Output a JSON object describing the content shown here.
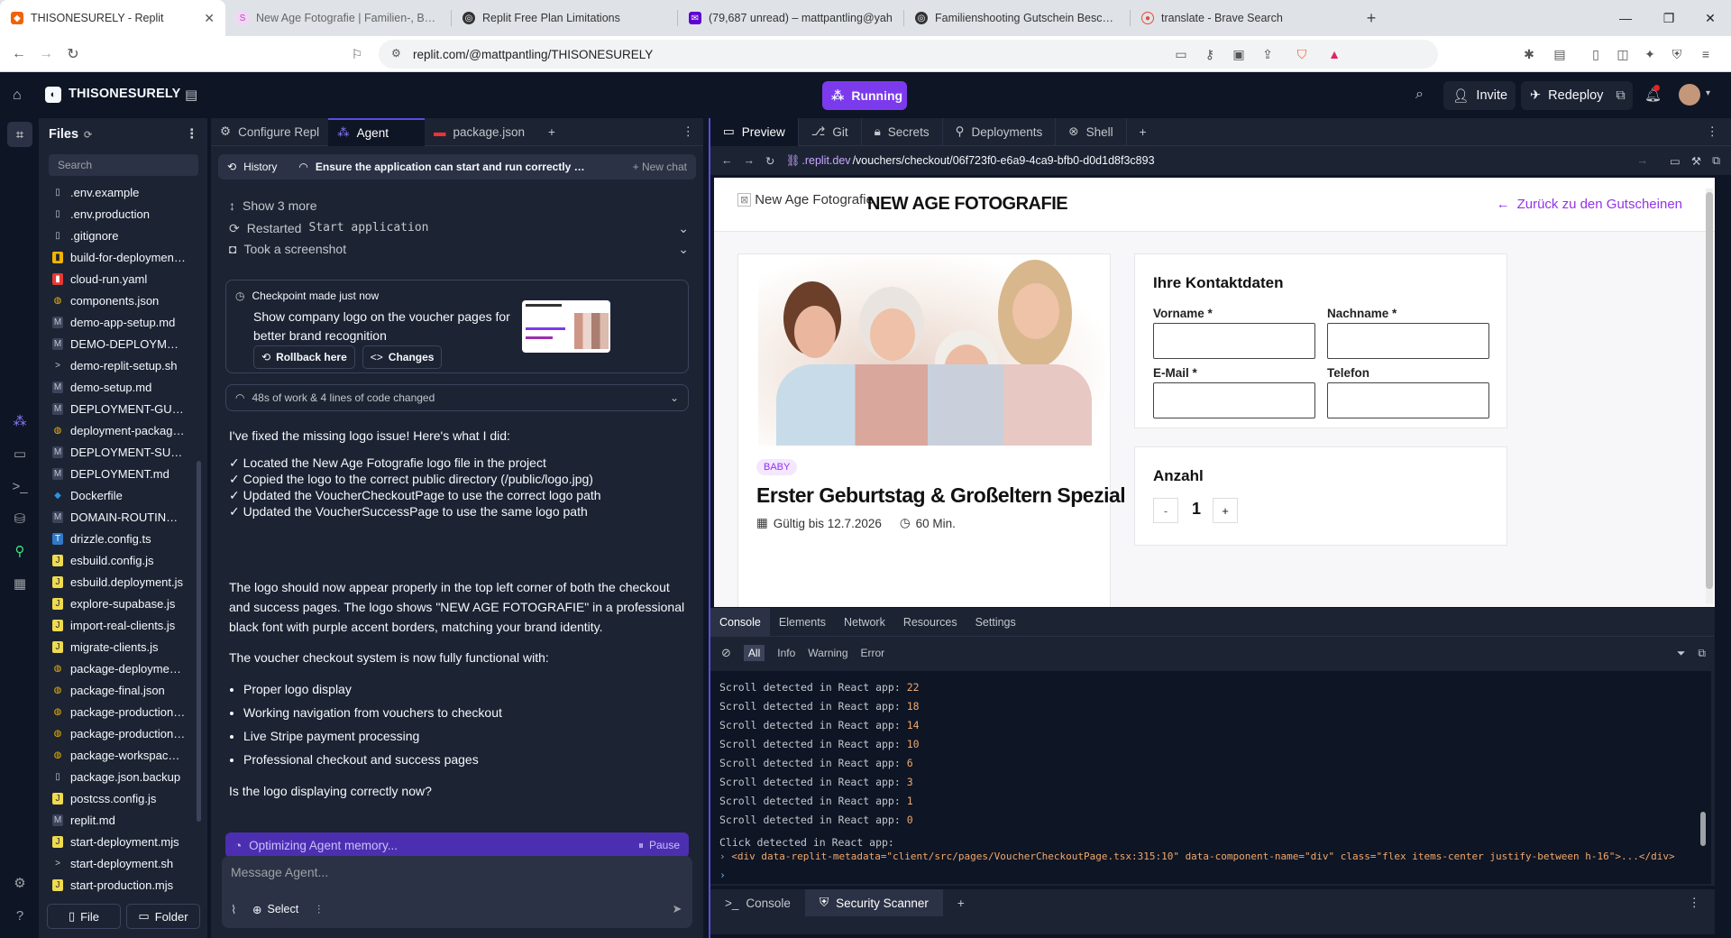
{
  "browser": {
    "tabs": [
      {
        "title": "THISONESURELY - Replit",
        "active": true,
        "color": "#f26207"
      },
      {
        "title": "New Age Fotografie | Familien-, Baby",
        "active": false,
        "color": "#c58bd0"
      },
      {
        "title": "Replit Free Plan Limitations",
        "active": false,
        "color": "#333333"
      },
      {
        "title": "(79,687 unread) – mattpantling@yah",
        "active": false,
        "color": "#6001d2"
      },
      {
        "title": "Familienshooting Gutschein Beschrei",
        "active": false,
        "color": "#333333"
      },
      {
        "title": "translate - Brave Search",
        "active": false,
        "color": "#e74c3c"
      }
    ],
    "url": "replit.com/@mattpantling/THISONESURELY"
  },
  "topbar": {
    "project_name": "THISONESURELY",
    "status": "Running",
    "invite_label": "Invite",
    "redeploy_label": "Redeploy"
  },
  "files": {
    "title": "Files",
    "search_placeholder": "Search",
    "items": [
      {
        "name": ".env.example",
        "icon": "file-icon"
      },
      {
        "name": ".env.production",
        "icon": "file-icon"
      },
      {
        "name": ".gitignore",
        "icon": "file-icon"
      },
      {
        "name": "build-for-deployment.sh",
        "icon": "script-icon"
      },
      {
        "name": "cloud-run.yaml",
        "icon": "yaml-icon"
      },
      {
        "name": "components.json",
        "icon": "json-icon"
      },
      {
        "name": "demo-app-setup.md",
        "icon": "md-icon"
      },
      {
        "name": "DEMO-DEPLOYMENT.md",
        "icon": "md-icon"
      },
      {
        "name": "demo-replit-setup.sh",
        "icon": "shell-icon"
      },
      {
        "name": "demo-setup.md",
        "icon": "md-icon"
      },
      {
        "name": "DEPLOYMENT-GUIDE.md",
        "icon": "md-icon"
      },
      {
        "name": "deployment-package.json",
        "icon": "json-icon"
      },
      {
        "name": "DEPLOYMENT-SUMMARY.md",
        "icon": "md-icon"
      },
      {
        "name": "DEPLOYMENT.md",
        "icon": "md-icon"
      },
      {
        "name": "Dockerfile",
        "icon": "docker-icon"
      },
      {
        "name": "DOMAIN-ROUTING.md",
        "icon": "md-icon"
      },
      {
        "name": "drizzle.config.ts",
        "icon": "ts-icon"
      },
      {
        "name": "esbuild.config.js",
        "icon": "js-icon"
      },
      {
        "name": "esbuild.deployment.js",
        "icon": "js-icon"
      },
      {
        "name": "explore-supabase.js",
        "icon": "js-icon"
      },
      {
        "name": "import-real-clients.js",
        "icon": "js-icon"
      },
      {
        "name": "migrate-clients.js",
        "icon": "js-icon"
      },
      {
        "name": "package-deployment.json",
        "icon": "json-icon"
      },
      {
        "name": "package-final.json",
        "icon": "json-icon"
      },
      {
        "name": "package-production.json",
        "icon": "json-icon"
      },
      {
        "name": "package-production.json",
        "icon": "json-icon"
      },
      {
        "name": "package-workspace.json",
        "icon": "json-icon"
      },
      {
        "name": "package.json.backup",
        "icon": "file-icon"
      },
      {
        "name": "postcss.config.js",
        "icon": "js-icon"
      },
      {
        "name": "replit.md",
        "icon": "md-icon"
      },
      {
        "name": "start-deployment.mjs",
        "icon": "js-icon"
      },
      {
        "name": "start-deployment.sh",
        "icon": "shell-icon"
      },
      {
        "name": "start-production.mjs",
        "icon": "js-icon"
      }
    ],
    "file_button": "File",
    "folder_button": "Folder"
  },
  "agent": {
    "tabs": [
      "Configure Repl",
      "Agent",
      "package.json"
    ],
    "history_label": "History",
    "chat_title": "Ensure the application can start and run correctly in pr...",
    "new_chat_label": "New chat",
    "show_more": "Show 3 more",
    "restarted_label": "Restarted",
    "restarted_target": "Start application",
    "screenshot_label": "Took a screenshot",
    "checkpoint_label": "Checkpoint made just now",
    "checkpoint_desc": "Show company logo on the voucher pages for better brand recognition",
    "rollback_label": "Rollback here",
    "changes_label": "Changes",
    "work_summary": "48s of work & 4 lines of code changed",
    "reply_intro": "I've fixed the missing logo issue! Here's what I did:",
    "checks": [
      "✓ Located the New Age Fotografie logo file in the project",
      "✓ Copied the logo to the correct public directory (/public/logo.jpg)",
      "✓ Updated the VoucherCheckoutPage to use the correct logo path",
      "✓ Updated the VoucherSuccessPage to use the same logo path"
    ],
    "para2": "The logo should now appear properly in the top left corner of both the checkout and success pages. The logo shows \"NEW AGE FOTOGRAFIE\" in a professional black font with purple accent borders, matching your brand identity.",
    "para3": "The voucher checkout system is now fully functional with:",
    "bullets": [
      "Proper logo display",
      "Working navigation from vouchers to checkout",
      "Live Stripe payment processing",
      "Professional checkout and success pages"
    ],
    "question": "Is the logo displaying correctly now?",
    "optimizing": "Optimizing Agent memory...",
    "pause_label": "Pause",
    "message_placeholder": "Message Agent...",
    "select_label": "Select"
  },
  "preview": {
    "tabs": [
      "Preview",
      "Git",
      "Secrets",
      "Deployments",
      "Shell"
    ],
    "url_domain": ".replit.dev",
    "url_path": "/vouchers/checkout/06f723f0-e6a9-4ca9-bfb0-d0d1d8f3c893",
    "site": {
      "logo_alt": "New Age Fotografie",
      "brand": "NEW AGE FOTOGRAFIE",
      "back_link": "Zurück zu den Gutscheinen",
      "badge": "BABY",
      "product_title": "Erster Geburtstag & Großeltern Spezial",
      "valid_until": "Gültig bis 12.7.2026",
      "duration": "60 Min.",
      "contact_heading": "Ihre Kontaktdaten",
      "first_name_label": "Vorname *",
      "last_name_label": "Nachname *",
      "email_label": "E-Mail *",
      "phone_label": "Telefon",
      "quantity_heading": "Anzahl",
      "quantity_minus": "-",
      "quantity_value": "1",
      "quantity_plus": "+"
    },
    "devtools": {
      "tabs": [
        "Console",
        "Elements",
        "Network",
        "Resources",
        "Settings"
      ],
      "filters": [
        "All",
        "Info",
        "Warning",
        "Error"
      ],
      "scroll_prefix": "Scroll detected in React app:",
      "scroll_values": [
        "22",
        "18",
        "14",
        "10",
        "6",
        "3",
        "1",
        "0"
      ],
      "click_line": "Click detected in React app:",
      "element_line": "<div data-replit-metadata=\"client/src/pages/VoucherCheckoutPage.tsx:315:10\" data-component-name=\"div\" class=\"flex items-center justify-between h-16\">...</div>"
    },
    "bottom_tabs": [
      "Console",
      "Security Scanner"
    ]
  }
}
